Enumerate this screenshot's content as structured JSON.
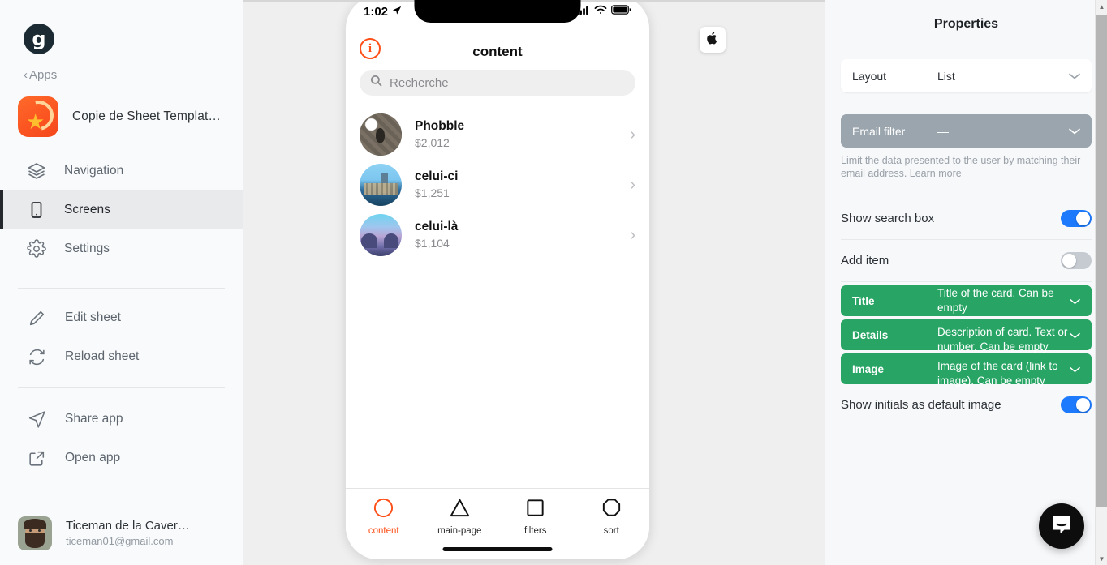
{
  "sidebar": {
    "logo_letter": "g",
    "back_label": "Apps",
    "app_name": "Copie de Sheet Templat…",
    "nav": [
      {
        "label": "Navigation",
        "icon": "layers-icon"
      },
      {
        "label": "Screens",
        "icon": "phone-icon"
      },
      {
        "label": "Settings",
        "icon": "gear-icon"
      }
    ],
    "tools": [
      {
        "label": "Edit sheet",
        "icon": "pencil-icon"
      },
      {
        "label": "Reload sheet",
        "icon": "refresh-icon"
      },
      {
        "label": "Share app",
        "icon": "send-icon"
      },
      {
        "label": "Open app",
        "icon": "external-link-icon"
      }
    ],
    "user": {
      "name": "Ticeman de la Caver…",
      "email": "ticeman01@gmail.com"
    }
  },
  "canvas": {
    "platform_button_icon": "apple-icon"
  },
  "phone": {
    "status": {
      "time": "1:02",
      "location_icon": "location-arrow-icon",
      "signal": "signal-icon",
      "wifi": "wifi-icon",
      "battery": "battery-icon"
    },
    "header": {
      "title": "content",
      "info_icon": "info-icon"
    },
    "search": {
      "placeholder": "Recherche",
      "icon": "search-icon"
    },
    "list": [
      {
        "name": "Phobble",
        "detail": "$2,012"
      },
      {
        "name": "celui-ci",
        "detail": "$1,251"
      },
      {
        "name": "celui-là",
        "detail": "$1,104"
      }
    ],
    "tabs": [
      {
        "label": "content",
        "icon": "circle-icon",
        "active": true
      },
      {
        "label": "main-page",
        "icon": "triangle-icon",
        "active": false
      },
      {
        "label": "filters",
        "icon": "square-icon",
        "active": false
      },
      {
        "label": "sort",
        "icon": "octagon-icon",
        "active": false
      }
    ]
  },
  "properties": {
    "title": "Properties",
    "layout": {
      "label": "Layout",
      "value": "List"
    },
    "email_filter": {
      "label": "Email filter",
      "value": "—"
    },
    "email_filter_help": "Limit the data presented to the user by matching their email address. ",
    "email_filter_link": "Learn more",
    "toggles": [
      {
        "label": "Show search box",
        "state": "on"
      },
      {
        "label": "Add item",
        "state": "off"
      }
    ],
    "fields": [
      {
        "label": "Title",
        "value": "Title of the card. Can be empty"
      },
      {
        "label": "Details",
        "value": "Description of card. Text or number. Can be empty"
      },
      {
        "label": "Image",
        "value": "Image of the card (link to image). Can be empty"
      }
    ],
    "initials_toggle": {
      "label": "Show initials as default image",
      "state": "on"
    }
  },
  "colors": {
    "accent_orange": "#ff4f18",
    "toggle_blue": "#1d7afc",
    "field_green": "#28a565",
    "filter_gray": "#9aa5ad"
  },
  "intercom": {
    "icon": "intercom-chat-icon"
  }
}
